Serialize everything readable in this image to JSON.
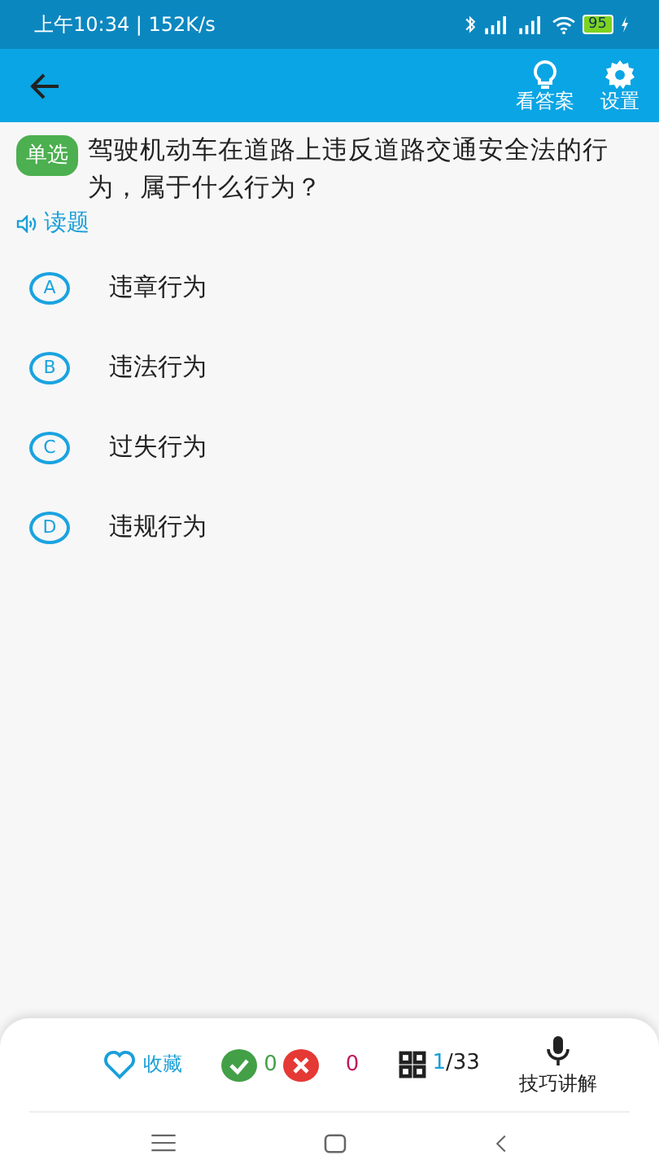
{
  "status_bar": {
    "time": "上午10:34 | 152K/s",
    "battery": "95"
  },
  "app_bar": {
    "actions": [
      {
        "kind": "bulb",
        "label": "看答案"
      },
      {
        "kind": "gear",
        "label": "设置"
      }
    ]
  },
  "question": {
    "type_badge": "单选",
    "text": "驾驶机动车在道路上违反道路交通安全法的行为，属于什么行为？",
    "read_aloud": "读题"
  },
  "options": [
    {
      "letter": "A",
      "text": "违章行为",
      "selected": false
    },
    {
      "letter": "B",
      "text": "违法行为",
      "selected": false
    },
    {
      "letter": "C",
      "text": "过失行为",
      "selected": false
    },
    {
      "letter": "D",
      "text": "违规行为",
      "selected": false
    }
  ],
  "bottom_bar": {
    "favorite": "收藏",
    "correct_count": "0",
    "wrong_count": "0",
    "progress_current": "1",
    "progress_total": "/33",
    "tips": "技巧讲解"
  }
}
